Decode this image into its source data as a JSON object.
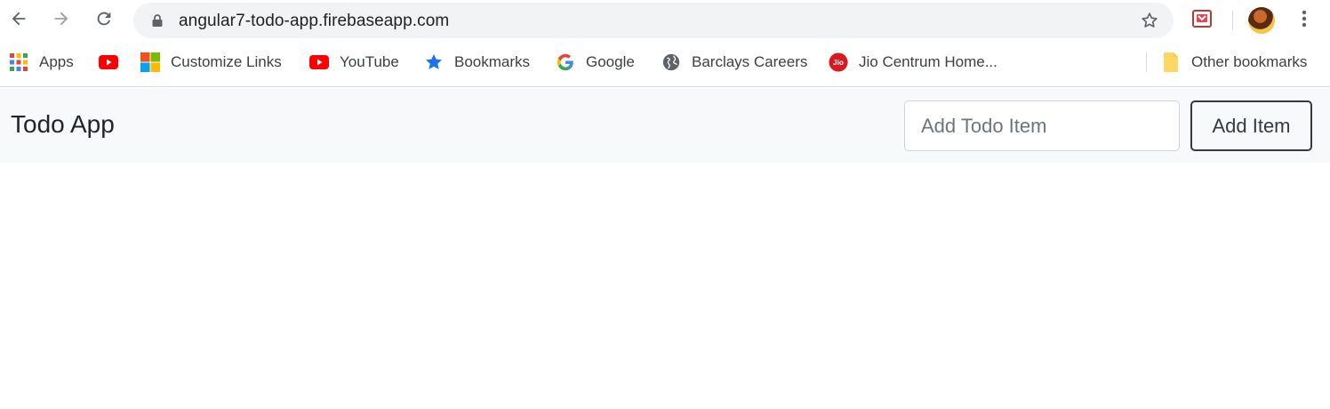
{
  "browser": {
    "url": "angular7-todo-app.firebaseapp.com",
    "icons": {
      "back": "arrow-left-icon",
      "forward": "arrow-right-icon",
      "reload": "reload-icon",
      "lock": "lock-icon",
      "star": "star-icon",
      "extension": "pocket-icon",
      "menu": "kebab-menu-icon"
    }
  },
  "bookmarks": {
    "items": [
      {
        "label": "Apps",
        "icon": "apps-grid-icon"
      },
      {
        "label": "",
        "icon": "youtube-icon"
      },
      {
        "label": "Customize Links",
        "icon": "microsoft-icon"
      },
      {
        "label": "YouTube",
        "icon": "youtube-icon"
      },
      {
        "label": "Bookmarks",
        "icon": "star-icon"
      },
      {
        "label": "Google",
        "icon": "google-icon"
      },
      {
        "label": "Barclays Careers",
        "icon": "globe-icon"
      },
      {
        "label": "Jio Centrum Home...",
        "icon": "jio-icon"
      }
    ],
    "other": {
      "label": "Other bookmarks",
      "icon": "folder-icon"
    }
  },
  "app": {
    "brand": "Todo App",
    "input": {
      "placeholder": "Add Todo Item",
      "value": ""
    },
    "add_button_label": "Add Item"
  },
  "colors": {
    "navbar_bg": "#f8f9fa",
    "button_border": "#343a40",
    "youtube_red": "#ff0000",
    "bookmark_star": "#1a73e8",
    "jio_red": "#d71920"
  }
}
